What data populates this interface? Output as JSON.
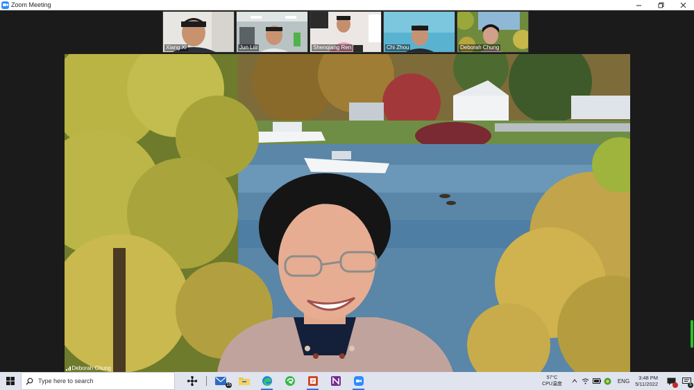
{
  "window": {
    "title": "Zoom Meeting"
  },
  "participants": [
    {
      "name": "Xiang Xi"
    },
    {
      "name": "Jun Liu"
    },
    {
      "name": "Shenqiang Ren"
    },
    {
      "name": "Chi Zhou"
    },
    {
      "name": "Deborah Chung"
    }
  ],
  "active_speaker": {
    "name": "Deborah Chung"
  },
  "taskbar": {
    "search_placeholder": "Type here to search",
    "mail_badge": "15",
    "apps": [
      "explorer-icon",
      "mail-icon",
      "file-manager-icon",
      "edge-icon",
      "edge-green-icon",
      "powerpoint-icon",
      "onenote-icon",
      "zoom-icon"
    ],
    "weather_temp": "57°C",
    "weather_label": "CPU温度",
    "language": "ENG",
    "time": "3:48 PM",
    "date": "5/11/2022",
    "notification_count": "5"
  },
  "colors": {
    "zoom_blue": "#2d8cff",
    "taskbar_bg": "#dfe4ef",
    "stage_bg": "#1b1b1b"
  }
}
